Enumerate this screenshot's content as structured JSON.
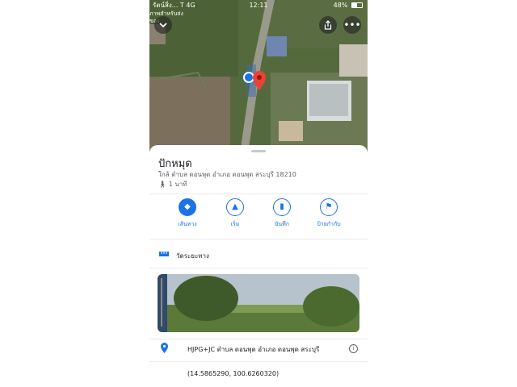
{
  "status_bar": {
    "carrier": "รัตน์สิ่ง... T 4G",
    "time": "12:11",
    "battery": "48%",
    "sub_label_1": "ภาพสำหรับส่ง",
    "sub_label_2": "ของ"
  },
  "map": {
    "back_icon": "chevron-down-icon",
    "share_icon": "share-icon",
    "more_icon": "more-horizontal-icon"
  },
  "place": {
    "title": "ปักหมุด",
    "address": "ใกล้ ตำบล ดอนพุด อำเภอ ดอนพุด สระบุรี 18210",
    "walk_time": "1 นาที"
  },
  "actions": [
    {
      "label": "เส้นทาง",
      "icon": "directions-icon"
    },
    {
      "label": "เริ่ม",
      "icon": "navigation-icon"
    },
    {
      "label": "บันทึก",
      "icon": "bookmark-icon"
    },
    {
      "label": "ป้ายกำกับ",
      "icon": "flag-icon"
    }
  ],
  "measure": {
    "label": "วัดระยะทาง",
    "icon": "ruler-icon"
  },
  "plus_code": {
    "label": "HJPG+JC ตำบล ดอนพุด อำเภอ ดอนพุด สระบุรี",
    "icon": "location-pin-icon"
  },
  "coordinates": "(14.5865290, 100.6260320)",
  "colors": {
    "accent": "#1a73e8",
    "pin": "#ea4335"
  }
}
